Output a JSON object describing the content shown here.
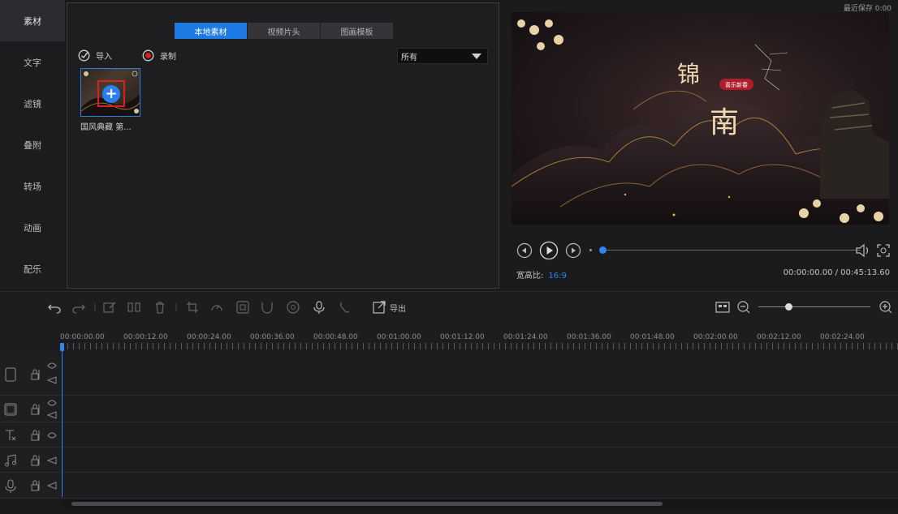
{
  "sidebar": {
    "items": [
      {
        "label": "素材"
      },
      {
        "label": "文字"
      },
      {
        "label": "滤镜"
      },
      {
        "label": "叠附"
      },
      {
        "label": "转场"
      },
      {
        "label": "动画"
      },
      {
        "label": "配乐"
      }
    ]
  },
  "media_panel": {
    "tabs": [
      {
        "label": "本地素材"
      },
      {
        "label": "视频片头"
      },
      {
        "label": "图画模板"
      }
    ],
    "import_label": "导入",
    "record_label": "录制",
    "filter": {
      "selected": "所有"
    },
    "items": [
      {
        "name": "国风典藏 第..."
      }
    ]
  },
  "preview": {
    "corner_label": "最近保存 0:00",
    "title_badge": "喜乐新春",
    "aspect_label": "宽高比:",
    "aspect_value": "16:9",
    "timecode": "00:00:00.00 / 00:45:13.60",
    "progress": 0.0
  },
  "toolbar": {
    "export_label": "导出",
    "zoom_level": 0.27
  },
  "timeline": {
    "ruler_labels": [
      "00:00:00.00",
      "00:00:12.00",
      "00:00:24.00",
      "00:00:36.00",
      "00:00:48.00",
      "00:01:00.00",
      "00:01:12.00",
      "00:01:24.00",
      "00:01:36.00",
      "00:01:48.00",
      "00:02:00.00",
      "00:02:12.00",
      "00:02:24.00"
    ]
  },
  "colors": {
    "accent": "#2f86f0",
    "highlight_box": "#e02020"
  }
}
